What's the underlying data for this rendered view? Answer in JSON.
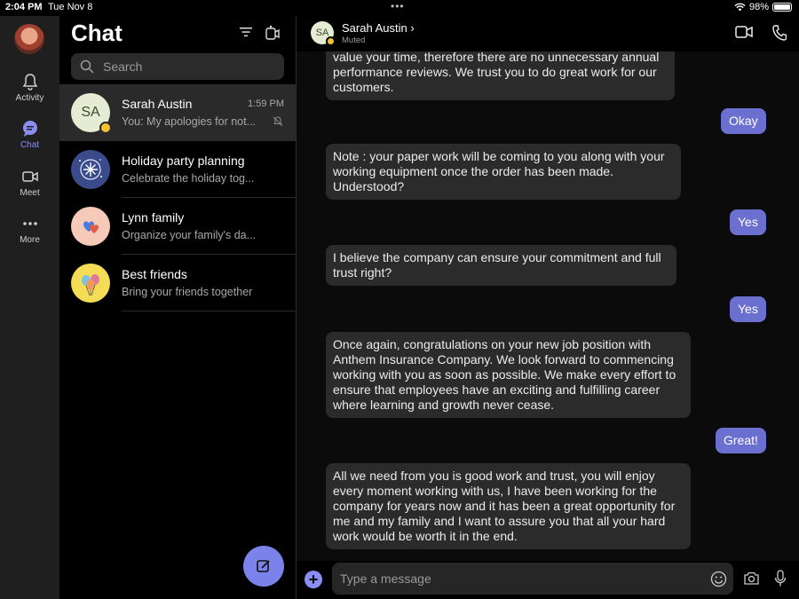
{
  "status_bar": {
    "time": "2:04 PM",
    "date": "Tue Nov 8",
    "battery": "98%",
    "battery_level": 0.98
  },
  "rail": {
    "items": [
      {
        "label": "Activity",
        "icon": "bell-icon"
      },
      {
        "label": "Chat",
        "icon": "chat-icon",
        "active": true
      },
      {
        "label": "Meet",
        "icon": "video-icon"
      },
      {
        "label": "More",
        "icon": "more-dots-icon"
      }
    ]
  },
  "chat_list": {
    "title": "Chat",
    "search_placeholder": "Search",
    "items": [
      {
        "name": "Sarah Austin",
        "initials": "SA",
        "preview": "You: My apologies for not...",
        "time": "1:59 PM",
        "muted": true
      },
      {
        "name": "Holiday party planning",
        "preview": "Celebrate the holiday tog..."
      },
      {
        "name": "Lynn family",
        "preview": "Organize your family's da..."
      },
      {
        "name": "Best friends",
        "preview": "Bring your friends together"
      }
    ]
  },
  "conversation": {
    "name": "Sarah Austin",
    "initials": "SA",
    "status": "Muted",
    "messages": [
      {
        "from": "them",
        "text": "value your time, therefore there are no unnecessary annual performance reviews. We trust you to do great work for our customers."
      },
      {
        "from": "me",
        "text": "Okay"
      },
      {
        "from": "them",
        "text": "Note : your paper work will be coming to you along with your working equipment once the order has been made. Understood?"
      },
      {
        "from": "me",
        "text": "Yes"
      },
      {
        "from": "them",
        "text": "I believe the company can ensure your commitment and full trust right?"
      },
      {
        "from": "me",
        "text": "Yes"
      },
      {
        "from": "them",
        "text": "Once again, congratulations on your new job position with Anthem Insurance Company. We look forward to commencing working with you as soon as possible. We make every effort to ensure that employees have an exciting and fulfilling career where learning and growth never cease."
      },
      {
        "from": "me",
        "text": "Great!"
      },
      {
        "from": "them",
        "text": "All we need from you is good work and trust, you will enjoy every moment working with us, I have been working for the company for years now and it has been a great opportunity for me and my family and I want to assure you that all your hard work would be worth it in the end."
      }
    ],
    "composer_placeholder": "Type a message"
  },
  "colors": {
    "accent": "#7b83eb",
    "my_bubble": "#6b6fd0",
    "their_bubble": "#2b2b2b",
    "away_badge": "#f1c232"
  }
}
